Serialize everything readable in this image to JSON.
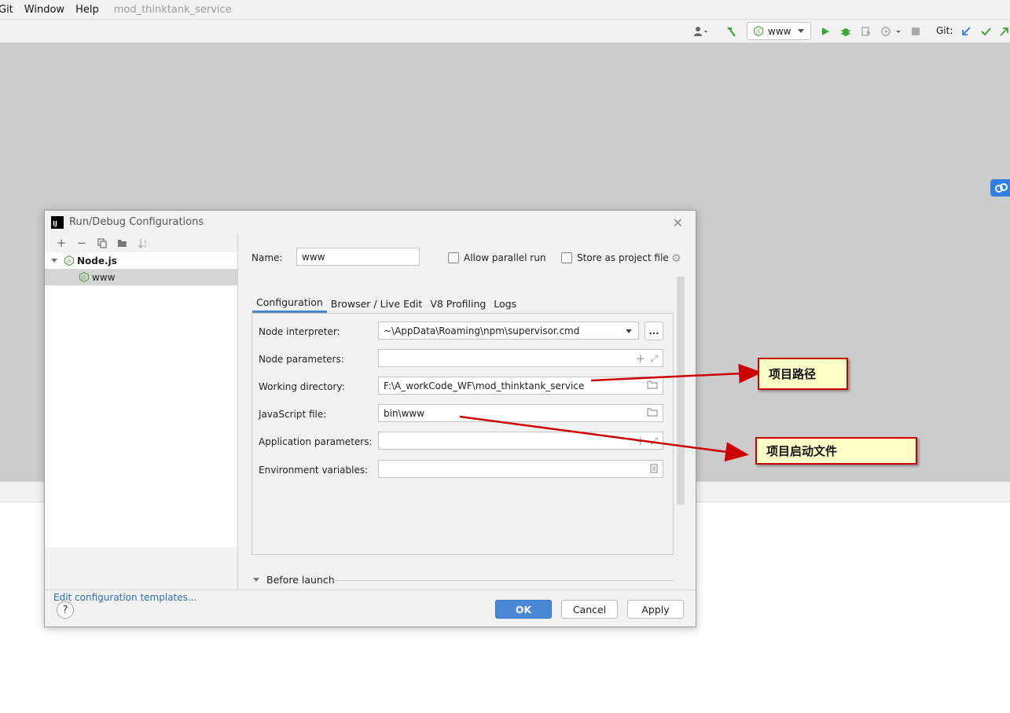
{
  "ide": {
    "menu": [
      "Git",
      "Window",
      "Help"
    ],
    "project_title": "mod_thinktank_service",
    "run_config": "www",
    "git_label": "Git:"
  },
  "dialog": {
    "title": "Run/Debug Configurations",
    "tree": {
      "group": "Node.js",
      "item": "www"
    },
    "edit_templates": "Edit configuration templates...",
    "name_label": "Name:",
    "name_value": "www",
    "allow_parallel_run": "Allow parallel run",
    "store_as_project_file": "Store as project file",
    "tabs": [
      "Configuration",
      "Browser / Live Edit",
      "V8 Profiling",
      "Logs"
    ],
    "fields": {
      "node_interpreter": {
        "label": "Node interpreter:",
        "value": "~\\AppData\\Roaming\\npm\\supervisor.cmd"
      },
      "node_parameters": {
        "label": "Node parameters:",
        "value": ""
      },
      "working_directory": {
        "label": "Working directory:",
        "value": "F:\\A_workCode_WF\\mod_thinktank_service"
      },
      "javascript_file": {
        "label": "JavaScript file:",
        "value": "bin\\www"
      },
      "application_parameters": {
        "label": "Application parameters:",
        "value": ""
      },
      "environment_variables": {
        "label": "Environment variables:",
        "value": ""
      }
    },
    "browse_button": "...",
    "before_launch": "Before launch",
    "buttons": {
      "ok": "OK",
      "cancel": "Cancel",
      "apply": "Apply"
    },
    "help": "?"
  },
  "annotations": {
    "project_path": "项目路径",
    "project_start_file": "项目启动文件"
  },
  "colors": {
    "accent_blue": "#4a88d6",
    "annotation_red": "#cc0000",
    "annotation_fill": "#ffffc8",
    "run_green": "#3aa63a"
  }
}
